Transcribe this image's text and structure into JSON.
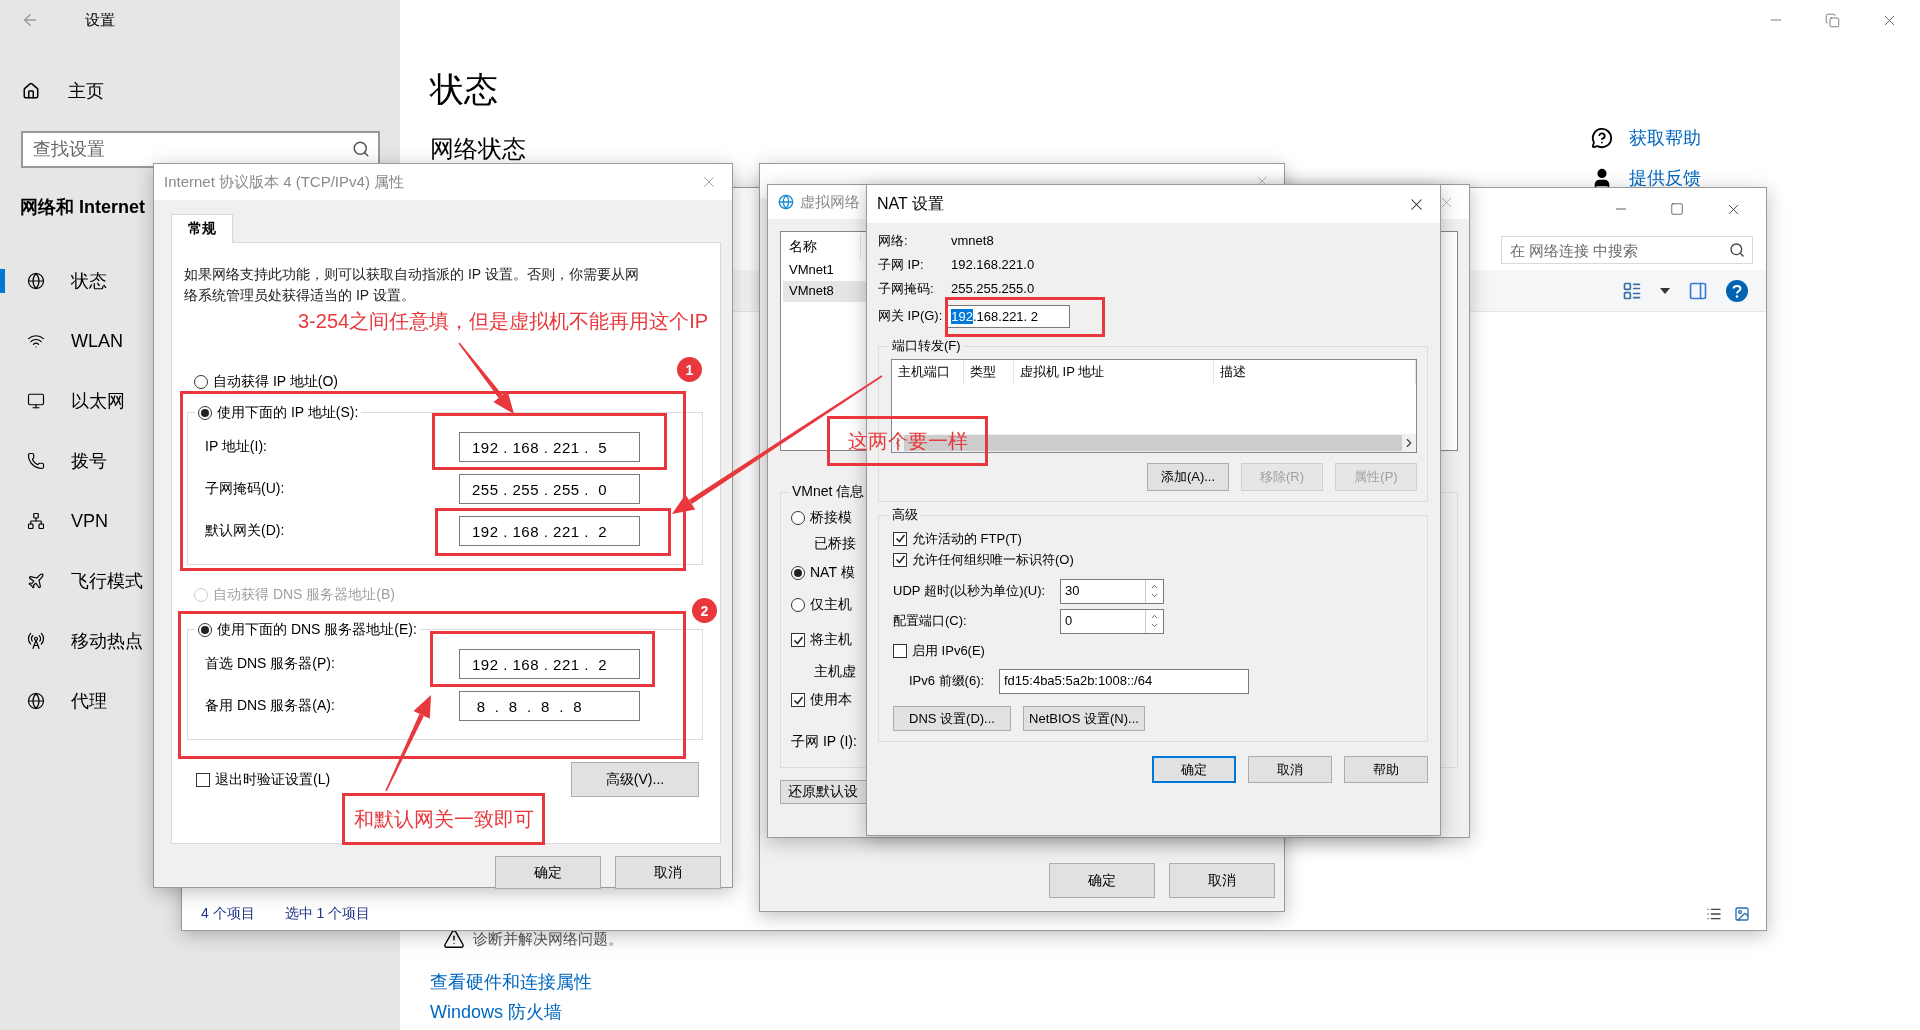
{
  "settings": {
    "title": "设置",
    "home": "主页",
    "search_placeholder": "查找设置",
    "section": "网络和 Internet",
    "nav": [
      {
        "label": "状态",
        "selected": true
      },
      {
        "label": "WLAN",
        "selected": false
      },
      {
        "label": "以太网",
        "selected": false
      },
      {
        "label": "拨号",
        "selected": false
      },
      {
        "label": "VPN",
        "selected": false
      },
      {
        "label": "飞行模式",
        "selected": false
      },
      {
        "label": "移动热点",
        "selected": false
      },
      {
        "label": "代理",
        "selected": false
      }
    ],
    "heading": "状态",
    "subheading": "网络状态",
    "help_links": [
      "获取帮助",
      "提供反馈"
    ],
    "troubleshoot": "诊断并解决网络问题。",
    "links": [
      "查看硬件和连接属性",
      "Windows 防火墙"
    ]
  },
  "explorer": {
    "search_placeholder": "在 网络连接 中搜索",
    "status": [
      "4 个项目",
      "选中 1 个项目"
    ]
  },
  "vmnet_props": {
    "buttons": [
      "确定",
      "取消"
    ]
  },
  "vnet_editor": {
    "title": "虚拟网络",
    "list_header": "名称",
    "networks": [
      {
        "name": "VMnet1",
        "selected": false
      },
      {
        "name": "VMnet8",
        "selected": true
      }
    ],
    "info_title": "VMnet 信息",
    "items": [
      {
        "kind": "radio",
        "label": "桥接模",
        "selected": false
      },
      {
        "kind": "note",
        "label": "已桥接"
      },
      {
        "kind": "radio",
        "label": "NAT 模",
        "selected": true
      },
      {
        "kind": "radio",
        "label": "仅主机",
        "selected": false
      },
      {
        "kind": "checkbox",
        "label": "将主机",
        "checked": true
      },
      {
        "kind": "note",
        "label": "主机虚"
      },
      {
        "kind": "checkbox",
        "label": "使用本",
        "checked": true
      }
    ],
    "subnet_label": "子网 IP (I):",
    "restore_button": "还原默认设"
  },
  "ipv4_dialog": {
    "title": "Internet 协议版本 4 (TCP/IPv4) 属性",
    "tabs": [
      {
        "label": "常规",
        "selected": true
      }
    ],
    "description": "如果网络支持此功能，则可以获取自动指派的 IP 设置。否则，你需要从网络系统管理员处获得适当的 IP 设置。",
    "ip_options": [
      {
        "label": "自动获得 IP 地址(O)",
        "selected": false
      },
      {
        "label": "使用下面的 IP 地址(S):",
        "selected": true
      }
    ],
    "ip_fields": [
      {
        "label": "IP 地址(I):",
        "value": "192 . 168 . 221 .  5"
      },
      {
        "label": "子网掩码(U):",
        "value": "255 . 255 . 255 .  0"
      },
      {
        "label": "默认网关(D):",
        "value": "192 . 168 . 221 .  2"
      }
    ],
    "dns_options": [
      {
        "label": "自动获得 DNS 服务器地址(B)",
        "selected": false,
        "disabled": true
      },
      {
        "label": "使用下面的 DNS 服务器地址(E):",
        "selected": true,
        "disabled": false
      }
    ],
    "dns_fields": [
      {
        "label": "首选 DNS 服务器(P):",
        "value": "192 . 168 . 221 .  2"
      },
      {
        "label": "备用 DNS 服务器(A):",
        "value": " 8  .  8  .  8  .  8"
      }
    ],
    "validate": {
      "label": "退出时验证设置(L)",
      "checked": false
    },
    "advanced_button": "高级(V)...",
    "buttons": [
      "确定",
      "取消"
    ]
  },
  "nat_dialog": {
    "title": "NAT 设置",
    "info": [
      {
        "label": "网络:",
        "value": "vmnet8"
      },
      {
        "label": "子网 IP:",
        "value": "192.168.221.0"
      },
      {
        "label": "子网掩码:",
        "value": "255.255.255.0"
      }
    ],
    "gateway": {
      "label": "网关 IP(G):",
      "selected_text": "192",
      "value": ".168.221. 2"
    },
    "port_forwarding": {
      "title": "端口转发(F)",
      "columns": [
        "主机端口",
        "类型",
        "虚拟机 IP 地址",
        "描述"
      ],
      "buttons": [
        {
          "label": "添加(A)...",
          "disabled": false
        },
        {
          "label": "移除(R)",
          "disabled": true
        },
        {
          "label": "属性(P)",
          "disabled": true
        }
      ]
    },
    "advanced": {
      "title": "高级",
      "checks": [
        {
          "label": "允许活动的 FTP(T)",
          "checked": true
        },
        {
          "label": "允许任何组织唯一标识符(O)",
          "checked": true
        }
      ],
      "spinners": [
        {
          "label": "UDP 超时(以秒为单位)(U):",
          "value": "30"
        },
        {
          "label": "配置端口(C):",
          "value": "0"
        }
      ],
      "ipv6": {
        "label": "启用 IPv6(E)",
        "checked": false
      },
      "prefix": {
        "label": "IPv6 前缀(6):",
        "value": "fd15:4ba5:5a2b:1008::/64"
      },
      "buttons": [
        "DNS 设置(D)...",
        "NetBIOS 设置(N)..."
      ]
    },
    "buttons": [
      {
        "label": "确定",
        "default": true
      },
      {
        "label": "取消",
        "default": false
      },
      {
        "label": "帮助",
        "default": false
      }
    ]
  },
  "annotations": {
    "callouts": [
      {
        "text": "3-254之间任意填，但是虚拟机不能再用这个IP",
        "boxed": false
      },
      {
        "text": "这两个要一样",
        "boxed": true
      },
      {
        "text": "和默认网关一致即可",
        "boxed": true
      }
    ],
    "markers": [
      "1",
      "2"
    ]
  }
}
